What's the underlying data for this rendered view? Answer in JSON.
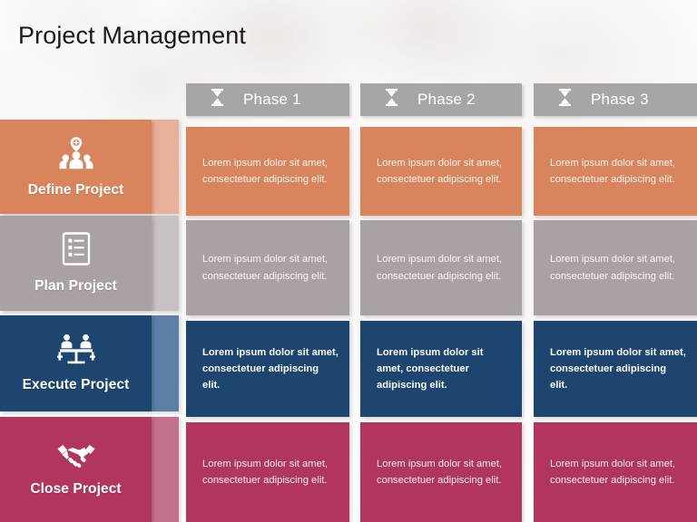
{
  "slide": {
    "title": "Project Management",
    "background_color": "#fbfafa",
    "title_color": "#1a1a1a"
  },
  "header": {
    "icon": "hourglass-icon",
    "bar_color": "#a6a6a6",
    "phases": [
      {
        "label": "Phase 1",
        "icon": "hourglass-icon"
      },
      {
        "label": "Phase 2",
        "icon": "hourglass-icon"
      },
      {
        "label": "Phase 3",
        "icon": "hourglass-icon"
      }
    ]
  },
  "body_text": "Lorem ipsum dolor sit amet, consectetuer adipiscing elit.",
  "rows": [
    {
      "label": "Define Project",
      "icon": "team-target-icon",
      "color": "#d9845c",
      "fold_color": "#e9b099",
      "cells": [
        "Lorem ipsum dolor sit amet, consectetuer adipiscing elit.",
        "Lorem ipsum dolor sit amet, consectetuer adipiscing elit.",
        "Lorem ipsum dolor sit amet, consectetuer adipiscing elit."
      ]
    },
    {
      "label": "Plan Project",
      "icon": "checklist-icon",
      "color": "#aaa1a4",
      "fold_color": "#c7c1c3",
      "cells": [
        "Lorem ipsum dolor sit amet, consectetuer adipiscing elit.",
        "Lorem ipsum dolor sit amet, consectetuer adipiscing elit.",
        "Lorem ipsum dolor sit amet, consectetuer adipiscing elit."
      ]
    },
    {
      "label": "Execute Project",
      "icon": "meeting-table-icon",
      "color": "#1c4570",
      "fold_color": "#5c80a5",
      "cells": [
        "Lorem ipsum dolor sit amet, consectetuer adipiscing elit.",
        "Lorem ipsum dolor sit amet, consectetuer adipiscing elit.",
        "Lorem ipsum dolor sit amet, consectetuer adipiscing elit."
      ]
    },
    {
      "label": "Close Project",
      "icon": "handshake-icon",
      "color": "#b2355e",
      "fold_color": "#c4718e",
      "cells": [
        "Lorem ipsum dolor sit amet, consectetuer adipiscing elit.",
        "Lorem ipsum dolor sit amet, consectetuer adipiscing elit.",
        "Lorem ipsum dolor sit amet, consectetuer adipiscing elit."
      ]
    }
  ]
}
